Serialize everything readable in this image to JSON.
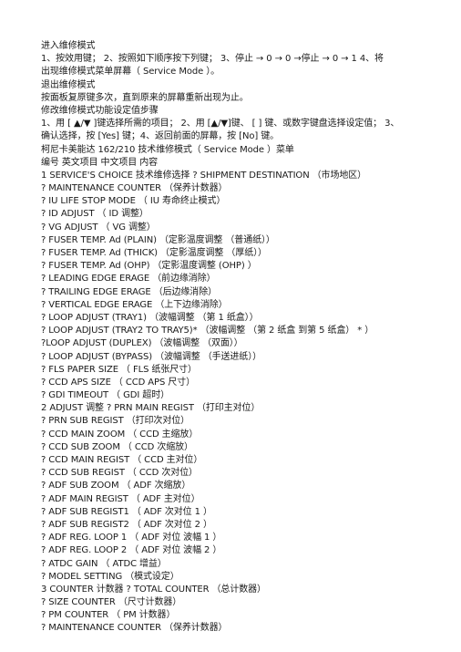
{
  "lines": [
    "进入维修模式",
    "1、按效用键； 2、按照如下顺序按下列键； 3、停止 → 0 → 0 →停止 → 0 → 1  4、将",
    "出现维修模式菜单屏幕（ Service Mode ）。",
    "退出维修模式",
    "按面板复原键多次，直到原来的屏幕重新出现为止。",
    "修改维修模式功能设定值步骤",
    "1、用 [ ▲/▼ ]键选择所需的项目； 2、用 [▲/▼]键、 [ ] 键、或数字键盘选择设定值； 3、",
    "确认选择，按 [Yes] 键；4、返回前面的屏幕，按 [No] 键。",
    "柯尼卡美能达 162/210 技术维修模式（ Service Mode ）菜单",
    "编号   英文项目   中文项目   内容",
    "1 SERVICE'S CHOICE   技术维修选择   ? SHIPMENT DESTINATION   （市场地区）",
    "? MAINTENANCE COUNTER   （保养计数器）",
    "? IU LIFE STOP MODE   （ IU 寿命终止模式）",
    "? ID ADJUST  （ ID 调整）",
    "? VG ADJUST  （ VG 调整）",
    "? FUSER TEMP. Ad (PLAIN)   （定影温度调整  （普通纸））",
    "? FUSER TEMP. Ad  (THICK)  （定影温度调整  （厚纸））",
    "? FUSER TEMP. Ad (OHP)   （定影温度调整  (OHP) ）",
    "? LEADING EDGE ERAGE   （前边缘消除）",
    "? TRAILING EDGE ERAGE   （后边缘消除）",
    "? VERTICAL EDGE ERAGE   （上下边缘消除）",
    "? LOOP ADJUST (TRAY1)   （波幅调整  （第 1 纸盒））",
    "? LOOP ADJUST (TRAY2 TO TRAY5)*   （波幅调整  （第 2 纸盒 到第 5 纸盒） * ）",
    "?LOOP ADJUST (DUPLEX)   （波幅调整  （双面））",
    "? LOOP ADJUST (BYPASS)   （波幅调整  （手送进纸））",
    "? FLS PAPER SIZE  （ FLS 纸张尺寸）",
    "? CCD APS SIZE  （ CCD APS 尺寸）",
    "? GDI TIMEOUT  （ GDI 超时）",
    "2 ADJUST  调整  ? PRN MAIN REGIST   （打印主对位）",
    "? PRN SUB REGIST   （打印次对位）",
    "? CCD MAIN ZOOM  （ CCD 主缩放）",
    "? CCD SUB ZOOM  （ CCD 次缩放）",
    "? CCD MAIN REGIST  （ CCD 主对位）",
    "? CCD SUB REGIST  （ CCD 次对位）",
    "? ADF SUB ZOOM  （ ADF 次缩放）",
    "? ADF MAIN REGIST  （ ADF 主对位）",
    "? ADF SUB REGIST1  （ ADF 次对位 1 ）",
    "? ADF SUB REGIST2  （ ADF 次对位 2 ）",
    "? ADF REG. LOOP 1  （ ADF 对位 波幅 1 ）",
    "? ADF REG. LOOP 2  （ ADF 对位 波幅 2 ）",
    "? ATDC GAIN  （ ATDC 增益）",
    "? MODEL SETTING   （模式设定）",
    "3 COUNTER  计数器  ? TOTAL COUNTER   （总计数器）",
    "? SIZE COUNTER   （尺寸计数器）",
    "? PM COUNTER  （ PM 计数器）",
    "? MAINTENANCE COUNTER   （保养计数器）"
  ]
}
